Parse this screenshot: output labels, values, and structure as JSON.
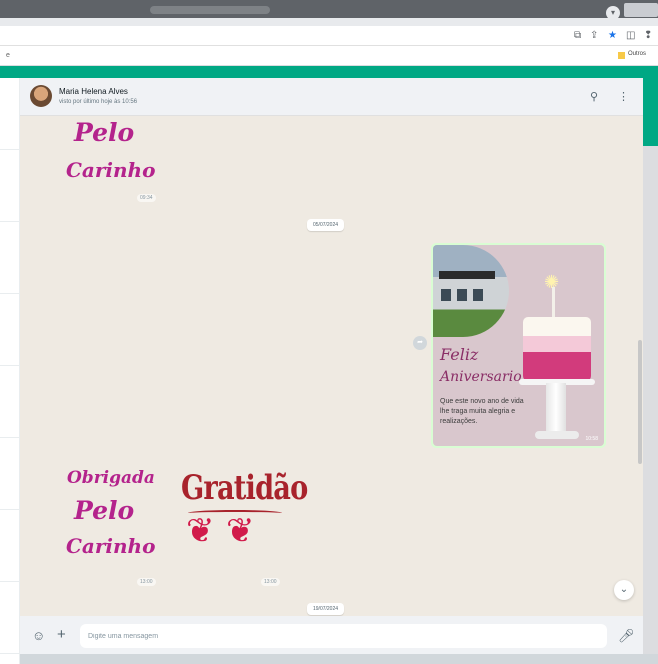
{
  "browser": {
    "bookmark_folder_label": "Outros"
  },
  "contact": {
    "name": "Maria Helena Alves",
    "status": "visto por último hoje às 10:56"
  },
  "messages": {
    "sticker_top": {
      "line1": "Pelo",
      "line2": "Carinho",
      "time": "09:34"
    },
    "date_1": "05/07/2024",
    "image_card": {
      "title_line1": "Feliz",
      "title_line2": "Aniversario",
      "text": "Que este novo ano de vida lhe traga muita alegria e realizações.",
      "time": "10:58"
    },
    "sticker_obrigada": {
      "line1": "Obrigada",
      "line2": "Pelo",
      "line3": "Carinho",
      "time": "13:00"
    },
    "sticker_gratidao": {
      "text": "Gratidão",
      "time": "13:00"
    },
    "date_2": "19/07/2024"
  },
  "composer": {
    "placeholder": "Digite uma mensagem"
  },
  "colors": {
    "accent": "#00a884",
    "chat_bg": "#efeae2",
    "sticker_pink": "#b4238c",
    "gratidao_red": "#a8232c"
  },
  "icons": [
    "search-icon",
    "menu-icon",
    "emoji-icon",
    "attach-icon",
    "mic-icon",
    "forward-icon",
    "chevron-down-icon",
    "star-icon",
    "folder-icon"
  ]
}
